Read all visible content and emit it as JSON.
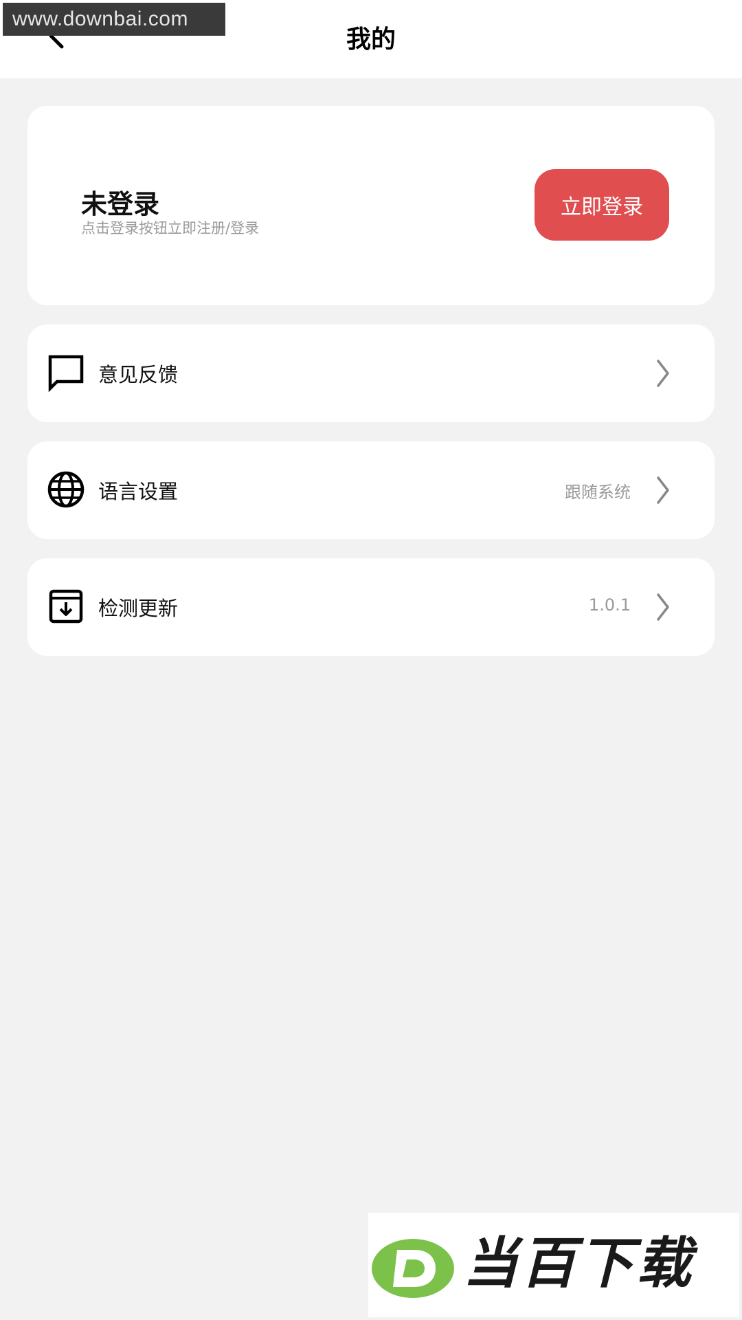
{
  "nav": {
    "title": "我的",
    "back_icon": "chevron-left-icon"
  },
  "watermark_top": {
    "text": "www.downbai.com"
  },
  "profile": {
    "title": "未登录",
    "subtitle": "点击登录按钮立即注册/登录",
    "login_label": "立即登录",
    "login_color": "#e04e50"
  },
  "menu": {
    "items": [
      {
        "label": "意见反馈",
        "value": "",
        "icon": "message-square-icon"
      },
      {
        "label": "语言设置",
        "value": "跟随系统",
        "icon": "globe-icon"
      },
      {
        "label": "检测更新",
        "value": "1.0.1",
        "icon": "download-box-icon"
      }
    ]
  },
  "watermark_bottom": {
    "text": "当百下载",
    "logo_letter": "D",
    "logo_color": "#7cc24a"
  }
}
